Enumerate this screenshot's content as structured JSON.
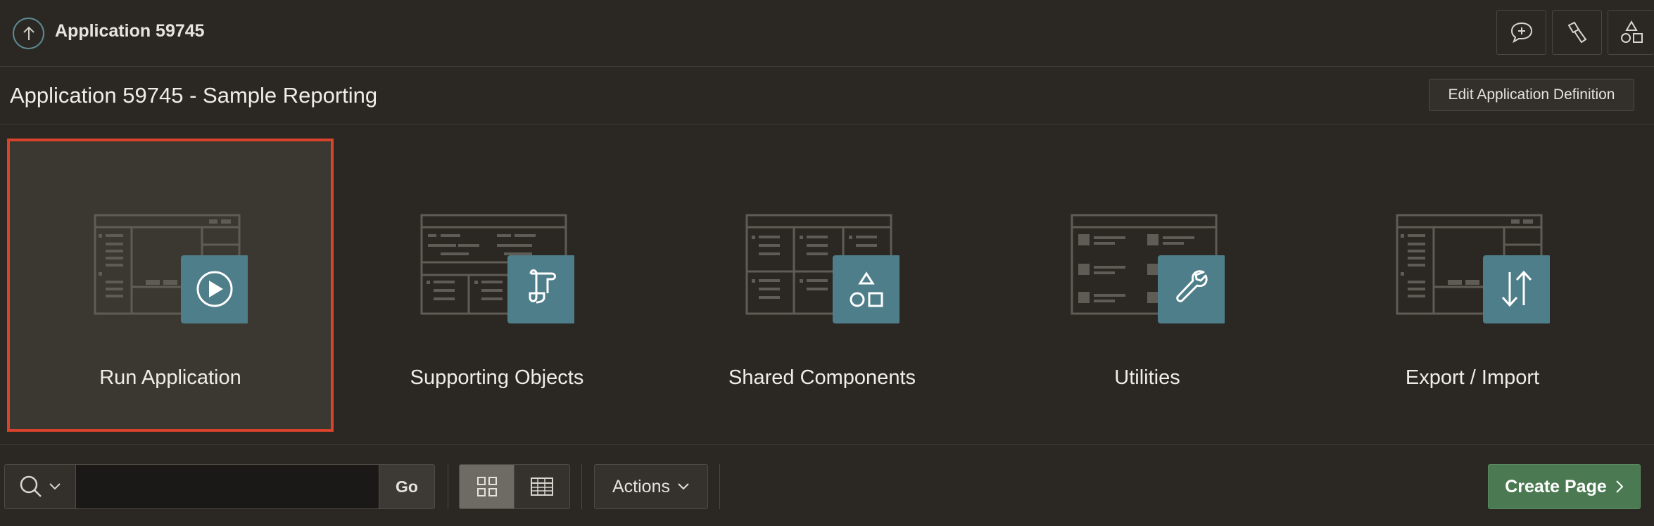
{
  "header": {
    "app_title": "Application 59745",
    "icons": [
      "comment-plus-icon",
      "flashlight-icon",
      "shapes-icon"
    ]
  },
  "subheader": {
    "title": "Application 59745 - Sample Reporting",
    "edit_definition_label": "Edit Application Definition"
  },
  "cards": [
    {
      "label": "Run Application",
      "icon": "play-icon",
      "selected": true
    },
    {
      "label": "Supporting Objects",
      "icon": "scroll-icon",
      "selected": false
    },
    {
      "label": "Shared Components",
      "icon": "shapes-icon",
      "selected": false
    },
    {
      "label": "Utilities",
      "icon": "wrench-icon",
      "selected": false
    },
    {
      "label": "Export / Import",
      "icon": "arrows-up-down-icon",
      "selected": false
    }
  ],
  "toolbar": {
    "search_value": "",
    "search_placeholder": "",
    "go_label": "Go",
    "actions_label": "Actions",
    "create_page_label": "Create Page"
  },
  "colors": {
    "background": "#2b2824",
    "accent_teal": "#4e7e89",
    "selected_outline": "#d9432c",
    "create_button": "#4b7a52"
  }
}
